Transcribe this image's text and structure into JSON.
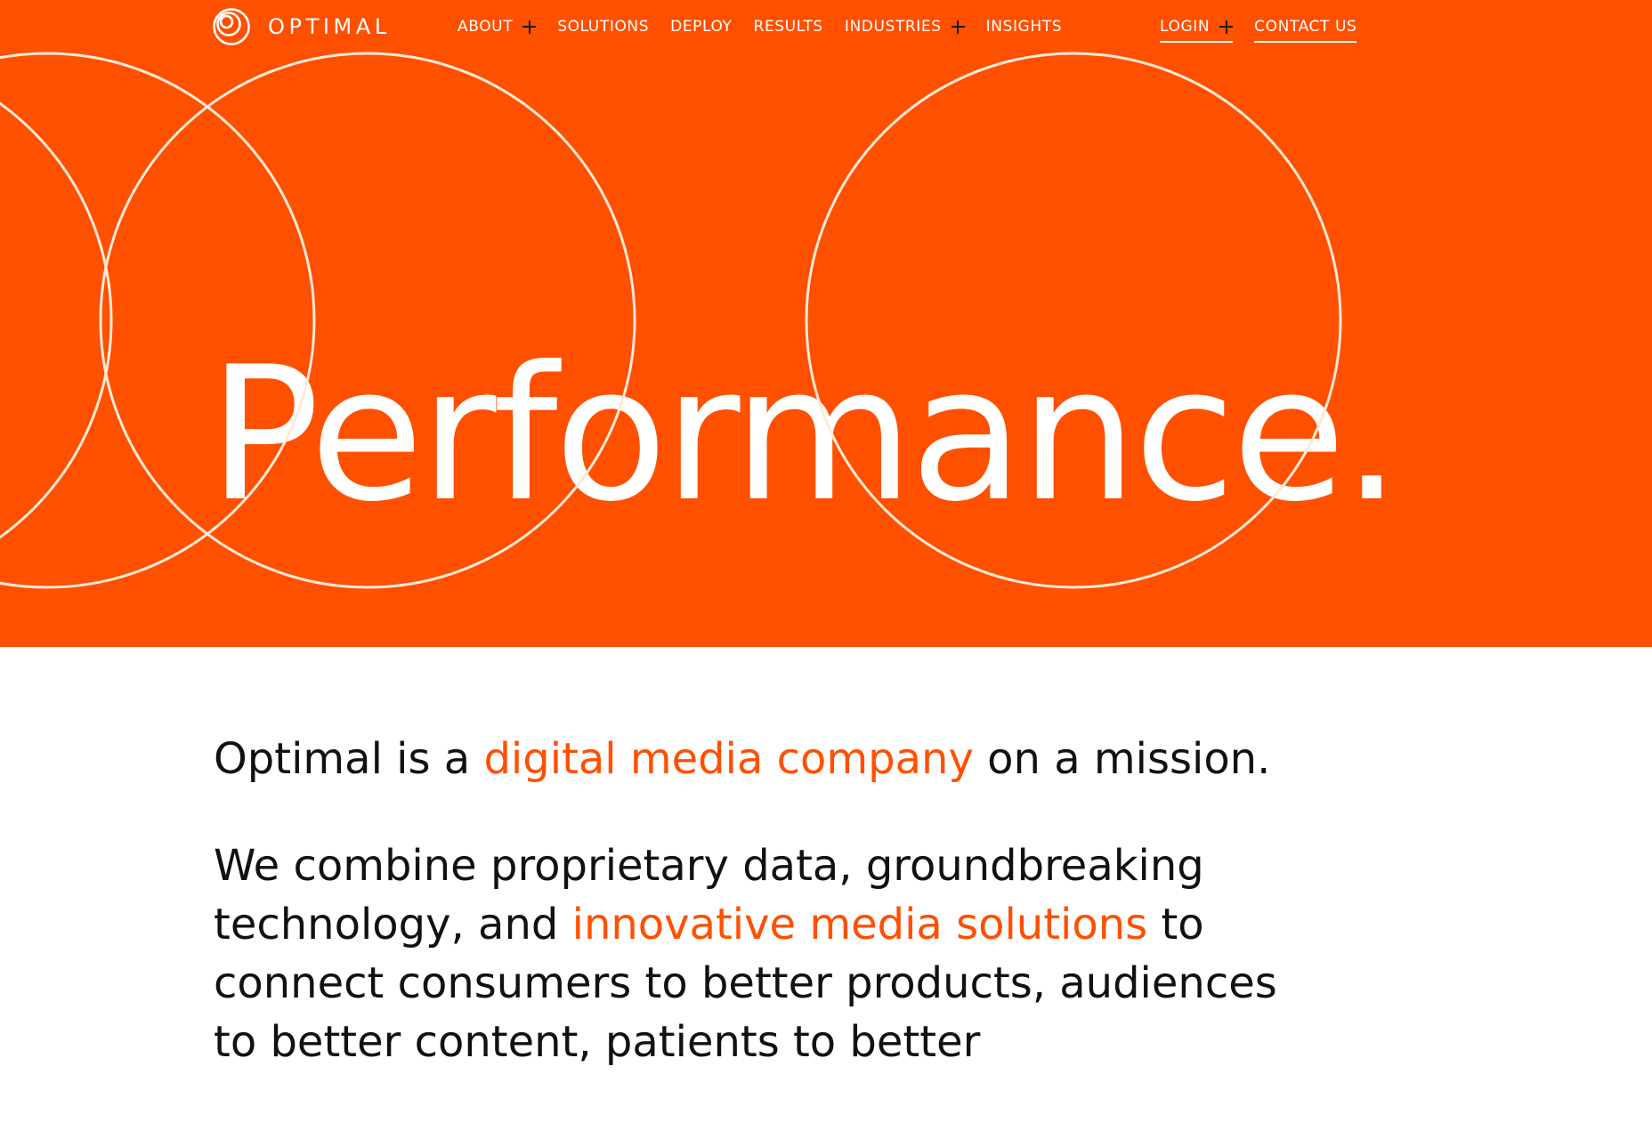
{
  "brand": {
    "name": "OPTIMAL",
    "logo_icon": "optimal-logo-icon",
    "accent_color": "#FF5000"
  },
  "nav": {
    "items": [
      {
        "label": "ABOUT",
        "has_submenu": true
      },
      {
        "label": "SOLUTIONS",
        "has_submenu": false
      },
      {
        "label": "DEPLOY",
        "has_submenu": false
      },
      {
        "label": "RESULTS",
        "has_submenu": false
      },
      {
        "label": "INDUSTRIES",
        "has_submenu": true
      },
      {
        "label": "INSIGHTS",
        "has_submenu": false
      }
    ],
    "login_label": "LOGIN",
    "contact_label": "CONTACT US"
  },
  "hero": {
    "headline": "Performance.",
    "background_color": "#FF5000",
    "decoration": "outlined-circles"
  },
  "intro": {
    "p1_before": "Optimal is a ",
    "p1_link": "digital media company",
    "p1_after": " on a mission.",
    "p2_before": "We combine proprietary data, groundbreaking technology, and ",
    "p2_link": "innovative media solutions",
    "p2_after": " to connect consumers to better products, audiences to better content, patients to better"
  }
}
